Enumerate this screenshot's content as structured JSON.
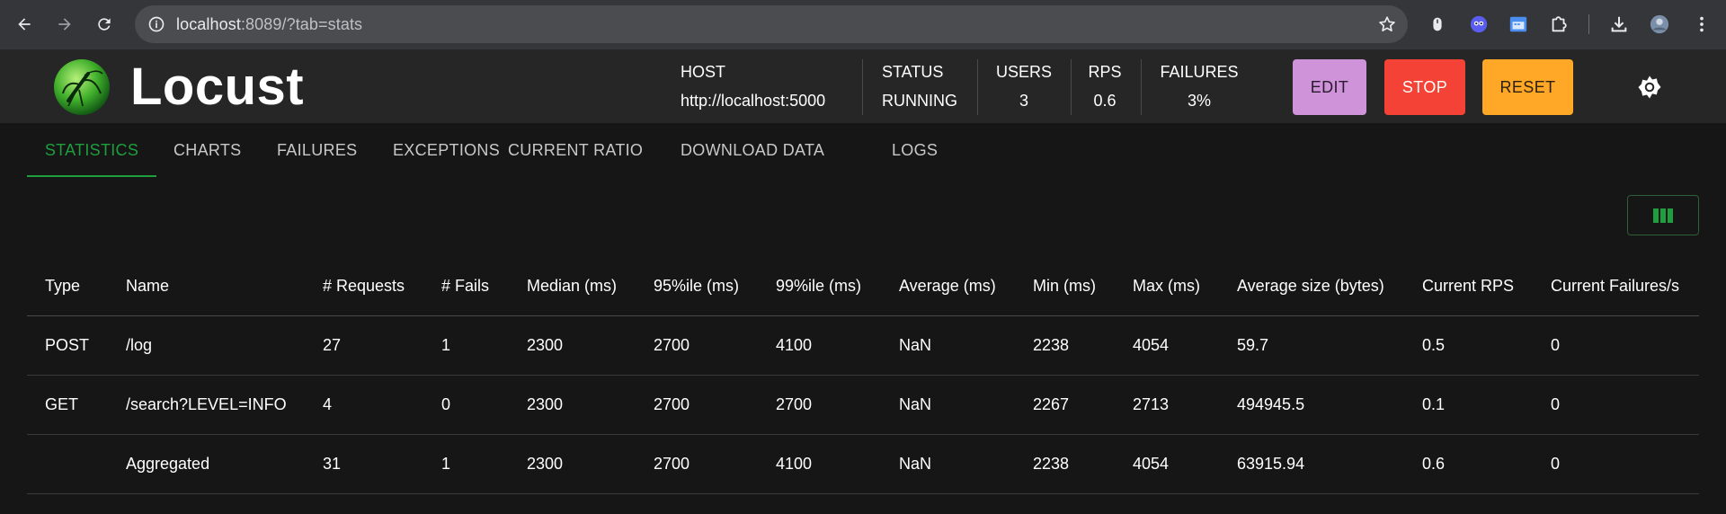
{
  "browser": {
    "url_host": "localhost",
    "url_path": ":8089/?tab=stats"
  },
  "app": {
    "title": "Locust"
  },
  "header": {
    "host_label": "HOST",
    "host_value": "http://localhost:5000",
    "status_label": "STATUS",
    "status_value": "RUNNING",
    "users_label": "USERS",
    "users_value": "3",
    "rps_label": "RPS",
    "rps_value": "0.6",
    "failures_label": "FAILURES",
    "failures_value": "3%",
    "edit_label": "EDIT",
    "stop_label": "STOP",
    "reset_label": "RESET"
  },
  "tabs": [
    {
      "label": "STATISTICS"
    },
    {
      "label": "CHARTS"
    },
    {
      "label": "FAILURES"
    },
    {
      "label": "EXCEPTIONS"
    },
    {
      "label": "CURRENT RATIO"
    },
    {
      "label": "DOWNLOAD DATA"
    },
    {
      "label": "LOGS"
    }
  ],
  "table": {
    "columns": [
      "Type",
      "Name",
      "# Requests",
      "# Fails",
      "Median (ms)",
      "95%ile (ms)",
      "99%ile (ms)",
      "Average (ms)",
      "Min (ms)",
      "Max (ms)",
      "Average size (bytes)",
      "Current RPS",
      "Current Failures/s"
    ],
    "rows": [
      [
        "POST",
        "/log",
        "27",
        "1",
        "2300",
        "2700",
        "4100",
        "NaN",
        "2238",
        "4054",
        "59.7",
        "0.5",
        "0"
      ],
      [
        "GET",
        "/search?LEVEL=INFO",
        "4",
        "0",
        "2300",
        "2700",
        "2700",
        "NaN",
        "2267",
        "2713",
        "494945.5",
        "0.1",
        "0"
      ],
      [
        "",
        "Aggregated",
        "31",
        "1",
        "2300",
        "2700",
        "4100",
        "NaN",
        "2238",
        "4054",
        "63915.94",
        "0.6",
        "0"
      ]
    ]
  },
  "colors": {
    "accent": "#1e9e3e",
    "edit": "#ce93d8",
    "stop": "#f44336",
    "reset": "#ffa726"
  }
}
